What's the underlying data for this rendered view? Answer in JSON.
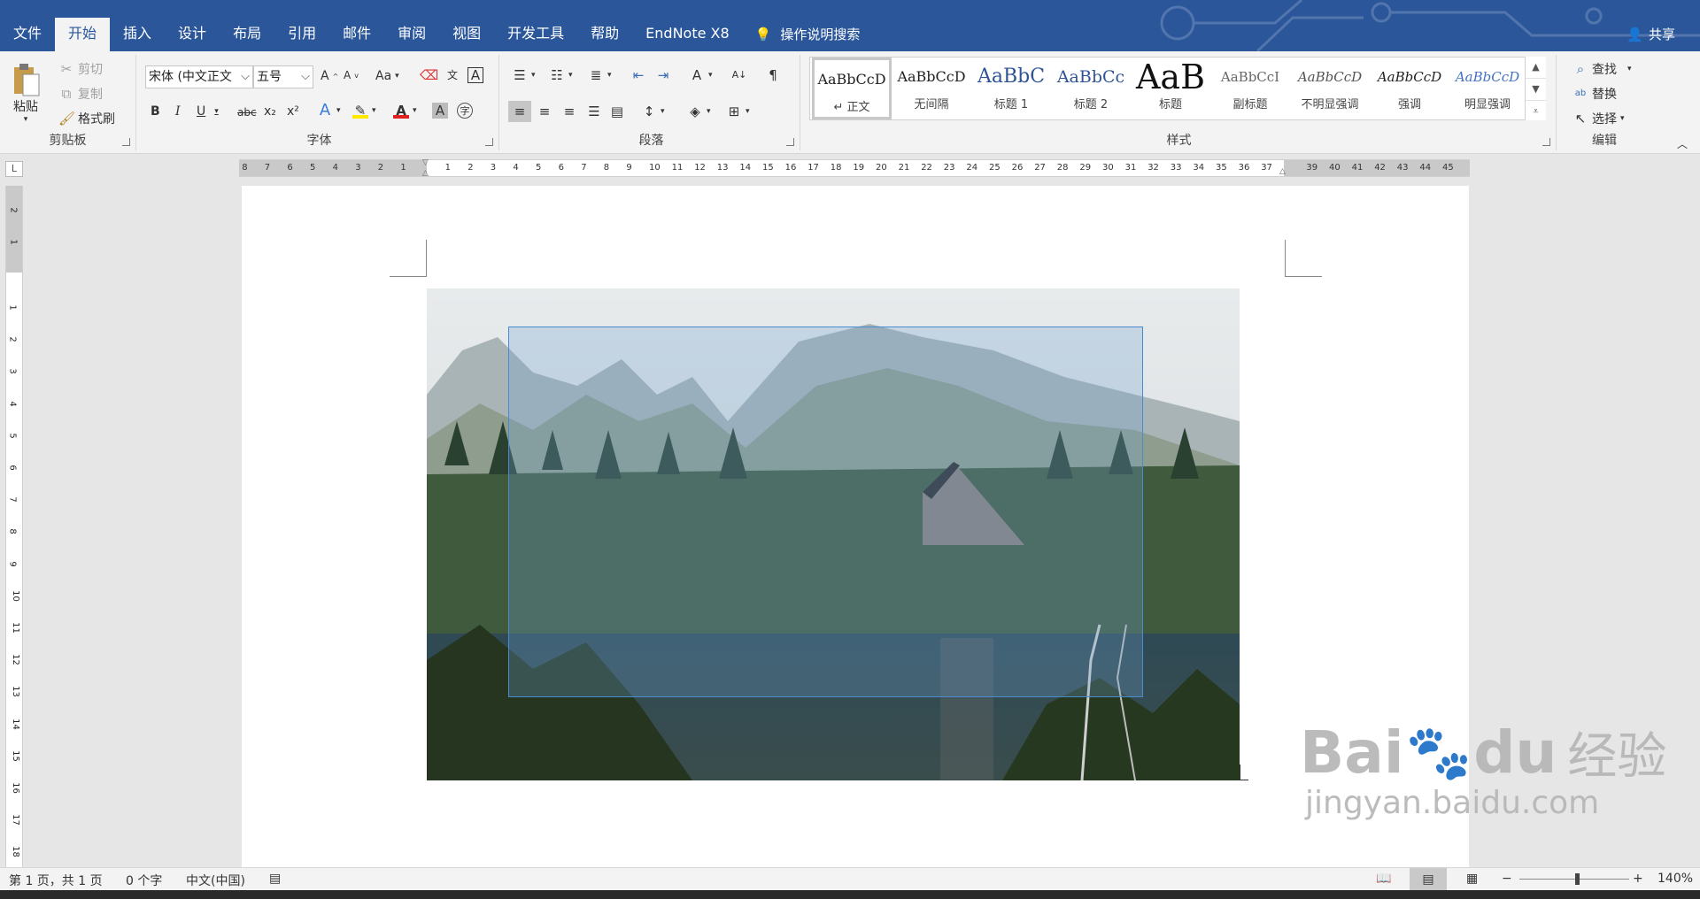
{
  "app": {
    "tabs": [
      "文件",
      "开始",
      "插入",
      "设计",
      "布局",
      "引用",
      "邮件",
      "审阅",
      "视图",
      "开发工具",
      "帮助",
      "EndNote X8"
    ],
    "active_tab": "开始",
    "tell_me": "操作说明搜索",
    "share": "共享"
  },
  "ribbon": {
    "clipboard": {
      "paste": "粘贴",
      "cut": "剪切",
      "copy": "复制",
      "format_painter": "格式刷",
      "label": "剪贴板"
    },
    "font": {
      "font_name": "宋体 (中文正文",
      "font_size": "五号",
      "change_case": "Aa",
      "label": "字体",
      "bold": "B",
      "italic": "I",
      "underline": "U",
      "strike": "abc",
      "sub": "x₂",
      "sup": "x²"
    },
    "paragraph": {
      "label": "段落"
    },
    "styles": {
      "label": "样式",
      "items": [
        {
          "sample": "AaBbCcD",
          "name": "↵ 正文"
        },
        {
          "sample": "AaBbCcD",
          "name": "无间隔"
        },
        {
          "sample": "AaBbC",
          "name": "标题 1"
        },
        {
          "sample": "AaBbCc",
          "name": "标题 2"
        },
        {
          "sample": "AaB",
          "name": "标题"
        },
        {
          "sample": "AaBbCcI",
          "name": "副标题"
        },
        {
          "sample": "AaBbCcD",
          "name": "不明显强调"
        },
        {
          "sample": "AaBbCcD",
          "name": "强调"
        },
        {
          "sample": "AaBbCcD",
          "name": "明显强调"
        }
      ]
    },
    "editing": {
      "find": "查找",
      "replace": "替换",
      "select": "选择",
      "label": "编辑"
    }
  },
  "ruler": {
    "left_numbers": [
      "8",
      "7",
      "6",
      "5",
      "4",
      "3",
      "2",
      "1"
    ],
    "right_numbers": [
      "1",
      "2",
      "3",
      "4",
      "5",
      "6",
      "7",
      "8",
      "9",
      "10",
      "11",
      "12",
      "13",
      "14",
      "15",
      "16",
      "17",
      "18",
      "19",
      "20",
      "21",
      "22",
      "23",
      "24",
      "25",
      "26",
      "27",
      "28",
      "29",
      "30",
      "31",
      "32",
      "33",
      "34",
      "35",
      "36",
      "37",
      "39",
      "40",
      "41",
      "42",
      "43",
      "44",
      "45"
    ],
    "vertical_top": [
      "2",
      "1"
    ],
    "vertical_numbers": [
      "1",
      "2",
      "3",
      "4",
      "5",
      "6",
      "7",
      "8",
      "9",
      "10",
      "11",
      "12",
      "13",
      "14",
      "15",
      "16",
      "17",
      "18"
    ]
  },
  "watermark": {
    "brand": "Bai",
    "brand2": "du",
    "cn": "经验",
    "url": "jingyan.baidu.com"
  },
  "status": {
    "page": "第 1 页，共 1 页",
    "words": "0 个字",
    "language": "中文(中国)",
    "zoom": "140%"
  },
  "colors": {
    "accent": "#2b579a",
    "selection": "#4a8bd0"
  }
}
